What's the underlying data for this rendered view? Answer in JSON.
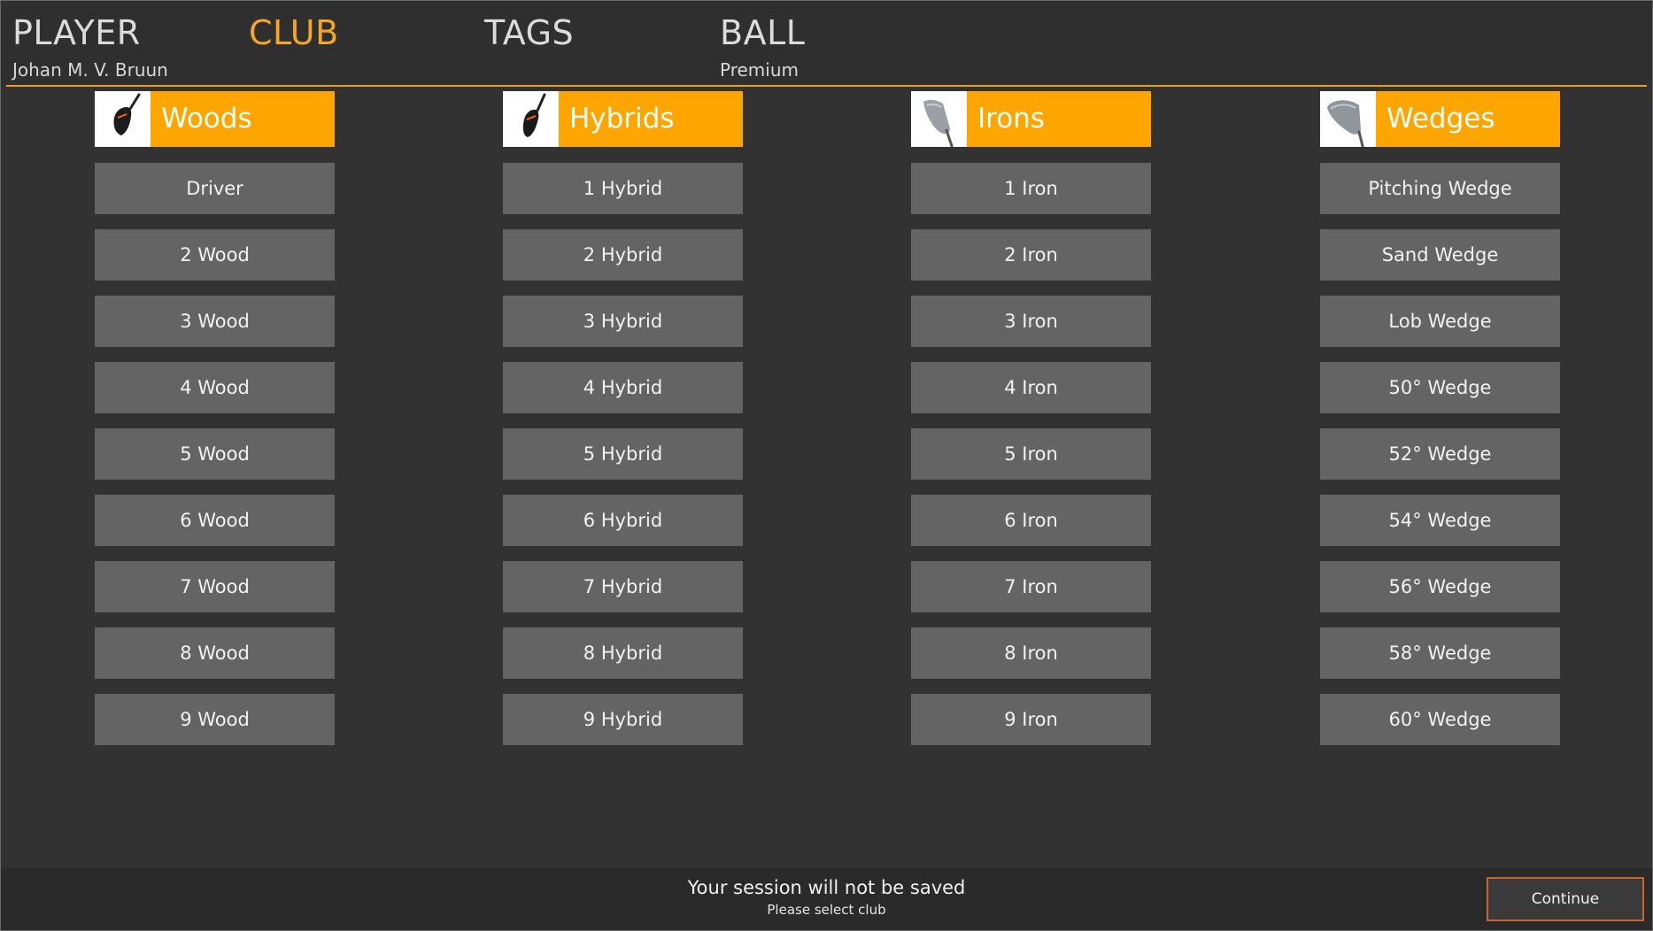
{
  "nav": {
    "tabs": [
      {
        "label": "PLAYER",
        "sub": "Johan M. V. Bruun",
        "active": false
      },
      {
        "label": "CLUB",
        "sub": "",
        "active": true
      },
      {
        "label": "TAGS",
        "sub": "",
        "active": false
      },
      {
        "label": "BALL",
        "sub": "Premium",
        "active": false
      }
    ]
  },
  "colors": {
    "accent": "#f5a623",
    "header_fill": "#ffa500",
    "button_fill": "#646464",
    "background": "#323232",
    "continue_border": "#c8652e"
  },
  "categories": [
    {
      "label": "Woods",
      "icon": "driver-club-icon",
      "clubs": [
        "Driver",
        "2 Wood",
        "3 Wood",
        "4 Wood",
        "5 Wood",
        "6 Wood",
        "7 Wood",
        "8 Wood",
        "9 Wood"
      ]
    },
    {
      "label": "Hybrids",
      "icon": "hybrid-club-icon",
      "clubs": [
        "1 Hybrid",
        "2 Hybrid",
        "3 Hybrid",
        "4 Hybrid",
        "5 Hybrid",
        "6 Hybrid",
        "7 Hybrid",
        "8 Hybrid",
        "9 Hybrid"
      ]
    },
    {
      "label": "Irons",
      "icon": "iron-club-icon",
      "clubs": [
        "1 Iron",
        "2 Iron",
        "3 Iron",
        "4 Iron",
        "5 Iron",
        "6 Iron",
        "7 Iron",
        "8 Iron",
        "9 Iron"
      ]
    },
    {
      "label": "Wedges",
      "icon": "wedge-club-icon",
      "clubs": [
        "Pitching Wedge",
        "Sand Wedge",
        "Lob Wedge",
        "50° Wedge",
        "52° Wedge",
        "54° Wedge",
        "56° Wedge",
        "58° Wedge",
        "60° Wedge"
      ]
    }
  ],
  "footer": {
    "message": "Your session will not be saved",
    "hint": "Please select club",
    "continue_label": "Continue"
  }
}
